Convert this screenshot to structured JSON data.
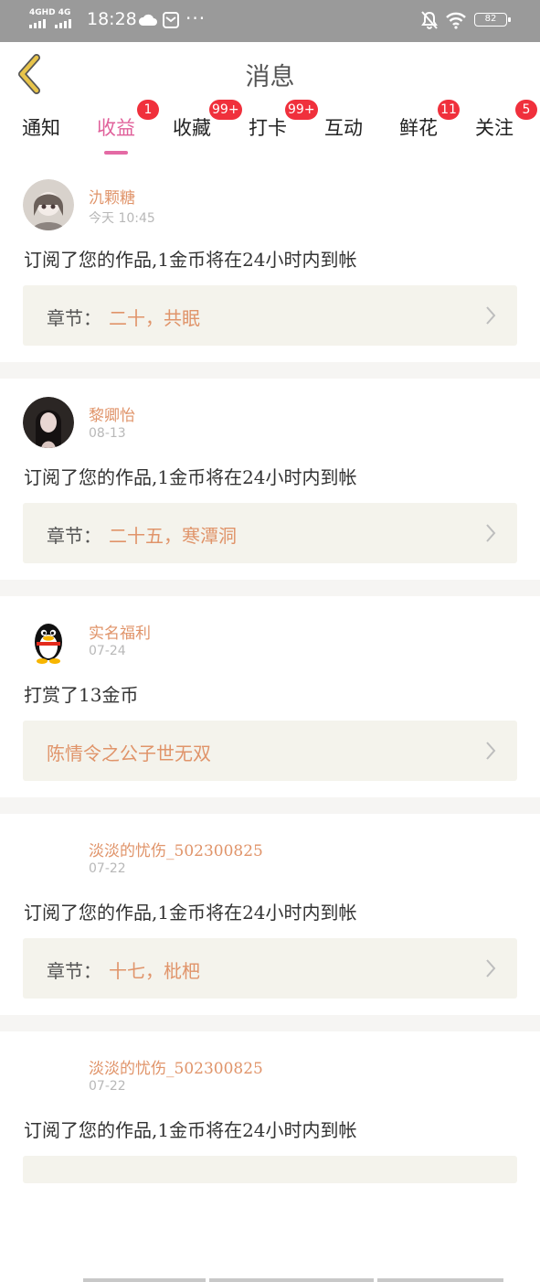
{
  "status_bar": {
    "network": "4GHD 4G",
    "time": "18:28",
    "more": "···",
    "battery": "82"
  },
  "header": {
    "title": "消息"
  },
  "tabs": [
    {
      "label": "通知",
      "badge": ""
    },
    {
      "label": "收益",
      "badge": "1",
      "active": true
    },
    {
      "label": "收藏",
      "badge": "99+"
    },
    {
      "label": "打卡",
      "badge": "99+"
    },
    {
      "label": "互动",
      "badge": ""
    },
    {
      "label": "鲜花",
      "badge": "11"
    },
    {
      "label": "关注",
      "badge": "5"
    }
  ],
  "messages": [
    {
      "name": "氿颗糖",
      "date": "今天 10:45",
      "text": "订阅了您的作品,1金币将在24小时内到帐",
      "chapter_label": "章节：",
      "chapter_title": "二十，共眠"
    },
    {
      "name": "黎卿怡",
      "date": "08-13",
      "text": "订阅了您的作品,1金币将在24小时内到帐",
      "chapter_label": "章节：",
      "chapter_title": "二十五，寒潭洞"
    },
    {
      "name": "实名福利",
      "date": "07-24",
      "text": "打赏了13金币",
      "chapter_label": "",
      "chapter_title": "陈情令之公子世无双"
    },
    {
      "name": "淡淡的忧伤_502300825",
      "date": "07-22",
      "text": "订阅了您的作品,1金币将在24小时内到帐",
      "chapter_label": "章节：",
      "chapter_title": "十七，枇杷"
    },
    {
      "name": "淡淡的忧伤_502300825",
      "date": "07-22",
      "text": "订阅了您的作品,1金币将在24小时内到帐"
    }
  ],
  "colors": {
    "accent_pink": "#e0609a",
    "name_orange": "#e0946a",
    "badge_red": "#f0303c",
    "chapter_bg": "#f4f3ec",
    "back_arrow": "#e8c44a"
  }
}
